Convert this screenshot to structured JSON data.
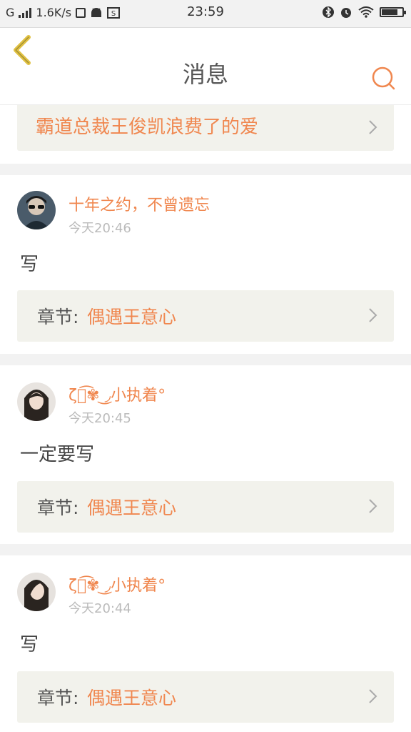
{
  "status_bar": {
    "carrier": "G",
    "net_speed": "1.6K/s",
    "time": "23:59",
    "icons": [
      "signal-icon",
      "sim-icon",
      "android-icon",
      "screenshot-icon",
      "bluetooth-icon",
      "alarm-icon",
      "wifi-icon",
      "battery-icon"
    ],
    "battery_level": 0.85
  },
  "header": {
    "title": "消息",
    "back_icon": "chevron-left-icon",
    "search_icon": "search-icon",
    "accent_color": "#f0874f",
    "back_color": "#e0c040"
  },
  "top_item": {
    "chapter_title": "霸道总裁王俊凯浪费了的爱"
  },
  "messages": [
    {
      "username": "十年之约，不曾遗忘",
      "time": "今天20:46",
      "comment": "写",
      "chapter_label": "章节:",
      "chapter_title": "偶遇王意心"
    },
    {
      "username": "ζั͡✾ ͜◞小执着°",
      "time": "今天20:45",
      "comment": "一定要写",
      "chapter_label": "章节:",
      "chapter_title": "偶遇王意心"
    },
    {
      "username": "ζั͡✾ ͜◞小执着°",
      "time": "今天20:44",
      "comment": "写",
      "chapter_label": "章节:",
      "chapter_title": "偶遇王意心"
    }
  ]
}
